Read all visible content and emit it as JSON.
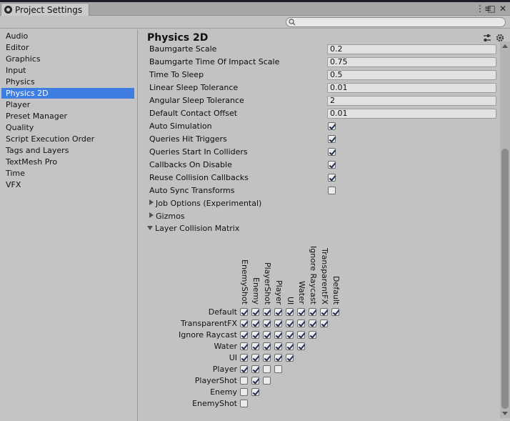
{
  "window": {
    "tab_title": "Project Settings",
    "controls": [
      "⋮≡",
      "□",
      "✕"
    ]
  },
  "search": {
    "placeholder": "",
    "value": ""
  },
  "sidebar": {
    "selected": "Physics 2D",
    "items": [
      {
        "label": "Audio"
      },
      {
        "label": "Editor"
      },
      {
        "label": "Graphics"
      },
      {
        "label": "Input"
      },
      {
        "label": "Physics"
      },
      {
        "label": "Physics 2D"
      },
      {
        "label": "Player"
      },
      {
        "label": "Preset Manager"
      },
      {
        "label": "Quality"
      },
      {
        "label": "Script Execution Order"
      },
      {
        "label": "Tags and Layers"
      },
      {
        "label": "TextMesh Pro"
      },
      {
        "label": "Time"
      },
      {
        "label": "VFX"
      }
    ]
  },
  "panel": {
    "title": "Physics 2D",
    "fields": [
      {
        "label": "Baumgarte Scale",
        "value": "0.2"
      },
      {
        "label": "Baumgarte Time Of Impact Scale",
        "value": "0.75"
      },
      {
        "label": "Time To Sleep",
        "value": "0.5"
      },
      {
        "label": "Linear Sleep Tolerance",
        "value": "0.01"
      },
      {
        "label": "Angular Sleep Tolerance",
        "value": "2"
      },
      {
        "label": "Default Contact Offset",
        "value": "0.01"
      }
    ],
    "toggles": [
      {
        "label": "Auto Simulation",
        "checked": true
      },
      {
        "label": "Queries Hit Triggers",
        "checked": true
      },
      {
        "label": "Queries Start In Colliders",
        "checked": true
      },
      {
        "label": "Callbacks On Disable",
        "checked": true
      },
      {
        "label": "Reuse Collision Callbacks",
        "checked": true
      },
      {
        "label": "Auto Sync Transforms",
        "checked": false
      }
    ],
    "foldouts": [
      {
        "label": "Job Options (Experimental)",
        "expanded": false
      },
      {
        "label": "Gizmos",
        "expanded": false
      },
      {
        "label": "Layer Collision Matrix",
        "expanded": true
      }
    ]
  },
  "matrix": {
    "column_labels": [
      "EnemyShot",
      "Enemy",
      "PlayerShot",
      "Player",
      "UI",
      "Water",
      "Ignore Raycast",
      "TransparentFX",
      "Default"
    ],
    "rows": [
      {
        "label": "Default",
        "checks": [
          true,
          true,
          true,
          true,
          true,
          true,
          true,
          true,
          true
        ]
      },
      {
        "label": "TransparentFX",
        "checks": [
          true,
          true,
          true,
          true,
          true,
          true,
          true,
          true
        ]
      },
      {
        "label": "Ignore Raycast",
        "checks": [
          true,
          true,
          true,
          true,
          true,
          true,
          true
        ]
      },
      {
        "label": "Water",
        "checks": [
          true,
          true,
          true,
          true,
          true,
          true
        ]
      },
      {
        "label": "UI",
        "checks": [
          true,
          true,
          true,
          true,
          true
        ]
      },
      {
        "label": "Player",
        "checks": [
          true,
          true,
          false,
          false
        ]
      },
      {
        "label": "PlayerShot",
        "checks": [
          false,
          true,
          false
        ]
      },
      {
        "label": "Enemy",
        "checks": [
          false,
          true
        ]
      },
      {
        "label": "EnemyShot",
        "checks": [
          false
        ]
      }
    ]
  },
  "colors": {
    "selection": "#3e7de1",
    "background": "#c2c2c2",
    "field": "#e2e2e2"
  }
}
